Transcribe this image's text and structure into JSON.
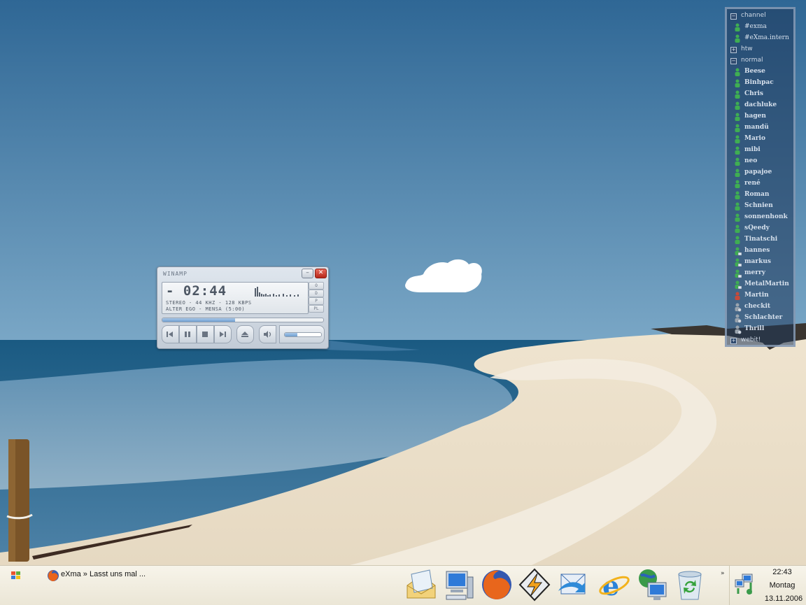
{
  "colors": {
    "sky_top": "#2f6795",
    "sky_bottom": "#7ba8c7",
    "sea": "#1e5f86",
    "sand": "#eee4d2",
    "contact_panel": "#1e375a",
    "taskbar": "#f3efe2"
  },
  "winamp": {
    "title": "WINAMP",
    "time": "- 02:44",
    "info": "STEREO - 44 KHZ - 128 KBPS",
    "song": "ALTER EGO - MENSA (5:00)",
    "seek_progress": 0.45,
    "volume_level": 0.35,
    "side_buttons": [
      "O",
      "D",
      "P",
      "PL"
    ],
    "controls": [
      "previous-icon",
      "pause-icon",
      "stop-icon",
      "next-icon",
      "eject-icon",
      "speaker-icon"
    ]
  },
  "contacts": {
    "groups": [
      {
        "label": "channel",
        "expanded": true,
        "items": [
          {
            "label": "#exma",
            "type": "channel"
          },
          {
            "label": "#eXma.intern",
            "type": "channel"
          }
        ]
      },
      {
        "label": "htw",
        "expanded": false,
        "items": []
      },
      {
        "label": "normal",
        "expanded": true,
        "items": [
          {
            "label": "Beese",
            "status": "online"
          },
          {
            "label": "Binhpac",
            "status": "online"
          },
          {
            "label": "Chris",
            "status": "online"
          },
          {
            "label": "dachluke",
            "status": "online"
          },
          {
            "label": "hagen",
            "status": "online"
          },
          {
            "label": "mandü",
            "status": "online"
          },
          {
            "label": "Mario",
            "status": "online"
          },
          {
            "label": "mibi",
            "status": "online"
          },
          {
            "label": "neo",
            "status": "online"
          },
          {
            "label": "papajoe",
            "status": "online"
          },
          {
            "label": "rené",
            "status": "online"
          },
          {
            "label": "Roman",
            "status": "online"
          },
          {
            "label": "Schnien",
            "status": "online"
          },
          {
            "label": "sonnenhonk",
            "status": "online"
          },
          {
            "label": "sQeedy",
            "status": "online"
          },
          {
            "label": "Tinatschi",
            "status": "online"
          },
          {
            "label": "hannes",
            "status": "away"
          },
          {
            "label": "markus",
            "status": "away"
          },
          {
            "label": "merry",
            "status": "away"
          },
          {
            "label": "MetalMartin",
            "status": "away"
          },
          {
            "label": "Martin",
            "status": "busy"
          },
          {
            "label": "checkit",
            "status": "idle"
          },
          {
            "label": "Schlachter",
            "status": "idle"
          },
          {
            "label": "Thrill",
            "status": "idle"
          }
        ]
      },
      {
        "label": "webit!",
        "expanded": false,
        "items": []
      }
    ]
  },
  "taskbar": {
    "task_label": "eXma » Lasst uns mal ...",
    "quicklaunch": [
      "mail-icon",
      "my-computer-icon",
      "firefox-icon",
      "winamp-icon",
      "outlook-icon",
      "internet-explorer-icon",
      "network-icon",
      "recycle-bin-icon"
    ],
    "tray_arrow": "»",
    "clock_time": "22:43",
    "clock_day": "Montag",
    "clock_date": "13.11.2006"
  }
}
